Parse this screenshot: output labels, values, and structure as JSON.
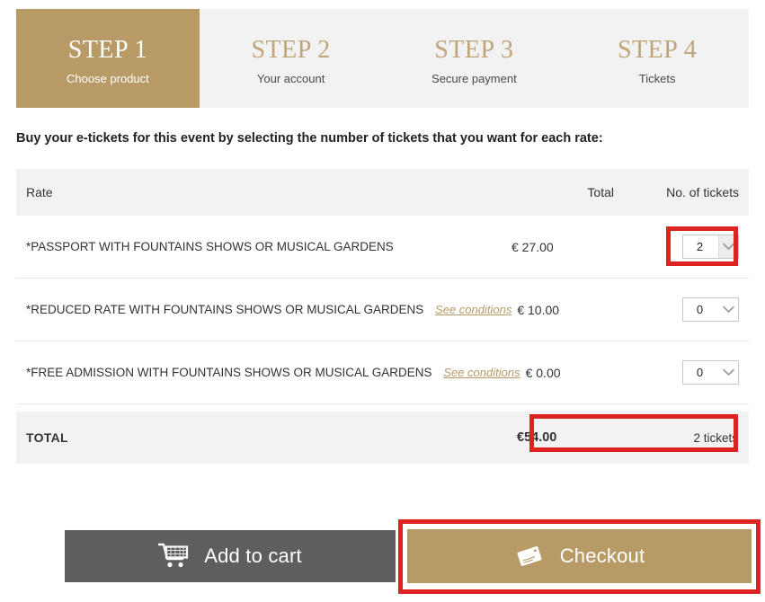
{
  "steps": [
    {
      "title": "STEP 1",
      "subtitle": "Choose product",
      "active": true
    },
    {
      "title": "STEP 2",
      "subtitle": "Your account",
      "active": false
    },
    {
      "title": "STEP 3",
      "subtitle": "Secure payment",
      "active": false
    },
    {
      "title": "STEP 4",
      "subtitle": "Tickets",
      "active": false
    }
  ],
  "intro": "Buy your e-tickets for this event by selecting the number of tickets that you want for each rate:",
  "table": {
    "headers": {
      "rate": "Rate",
      "total": "Total",
      "tickets": "No. of tickets"
    },
    "rows": [
      {
        "rate": "*PASSPORT WITH FOUNTAINS SHOWS OR MUSICAL GARDENS",
        "conditions": "",
        "price": "€ 27.00",
        "qty": "2",
        "highlighted": true
      },
      {
        "rate": "*REDUCED RATE WITH FOUNTAINS SHOWS OR MUSICAL GARDENS",
        "conditions": "See conditions",
        "price": "€ 10.00",
        "qty": "0",
        "highlighted": false
      },
      {
        "rate": "*FREE ADMISSION WITH FOUNTAINS SHOWS OR MUSICAL GARDENS",
        "conditions": "See conditions",
        "price": "€ 0.00",
        "qty": "0",
        "highlighted": false
      }
    ],
    "total": {
      "label": "TOTAL",
      "amount": "€54.00",
      "count": "2 tickets"
    }
  },
  "buttons": {
    "add_to_cart": {
      "label": "Add to cart",
      "icon": "shopping-cart-icon"
    },
    "checkout": {
      "label": "Checkout",
      "icon": "ticket-icon"
    }
  },
  "colors": {
    "gold": "#b89a66",
    "gold_text": "#c0a579",
    "band": "#f2f2f2",
    "dark_button": "#5e5e5e",
    "annotation_red": "#dd2222"
  }
}
